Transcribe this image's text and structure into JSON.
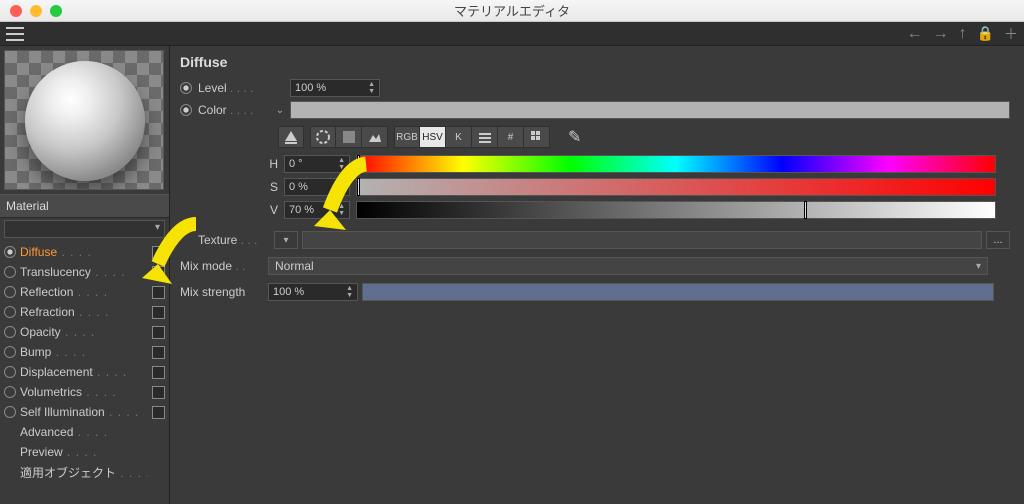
{
  "window": {
    "title": "マテリアルエディタ"
  },
  "sidebar": {
    "section_label": "Material",
    "channels": [
      {
        "label": "Diffuse",
        "radio": true,
        "checked": true,
        "active": true
      },
      {
        "label": "Translucency",
        "radio": true,
        "checked": false
      },
      {
        "label": "Reflection",
        "radio": true,
        "checked": false
      },
      {
        "label": "Refraction",
        "radio": true,
        "checked": false
      },
      {
        "label": "Opacity",
        "radio": true,
        "checked": false
      },
      {
        "label": "Bump",
        "radio": true,
        "checked": false
      },
      {
        "label": "Displacement",
        "radio": true,
        "checked": false
      },
      {
        "label": "Volumetrics",
        "radio": true,
        "checked": false
      },
      {
        "label": "Self Illumination",
        "radio": true,
        "checked": false
      },
      {
        "label": "Advanced",
        "radio": false,
        "nochk": true
      },
      {
        "label": "Preview",
        "radio": false,
        "nochk": true
      },
      {
        "label": "適用オブジェクト",
        "radio": false,
        "nochk": true
      }
    ]
  },
  "panel": {
    "title": "Diffuse",
    "level": {
      "label": "Level",
      "value": "100 %"
    },
    "color": {
      "label": "Color",
      "swatch": "#b3b3b3"
    },
    "modes": {
      "rgb": "RGB",
      "hsv": "HSV",
      "k": "K",
      "grid": "#",
      "active": "HSV"
    },
    "hsv": {
      "h": {
        "label": "H",
        "value": "0 °",
        "thumb_pct": 0
      },
      "s": {
        "label": "S",
        "value": "0 %",
        "thumb_pct": 0
      },
      "v": {
        "label": "V",
        "value": "70 %",
        "thumb_pct": 70
      }
    },
    "texture": {
      "label": "Texture",
      "path": "",
      "browse": "..."
    },
    "mixmode": {
      "label": "Mix mode",
      "value": "Normal"
    },
    "mixstrength": {
      "label": "Mix strength",
      "value": "100 %"
    }
  }
}
